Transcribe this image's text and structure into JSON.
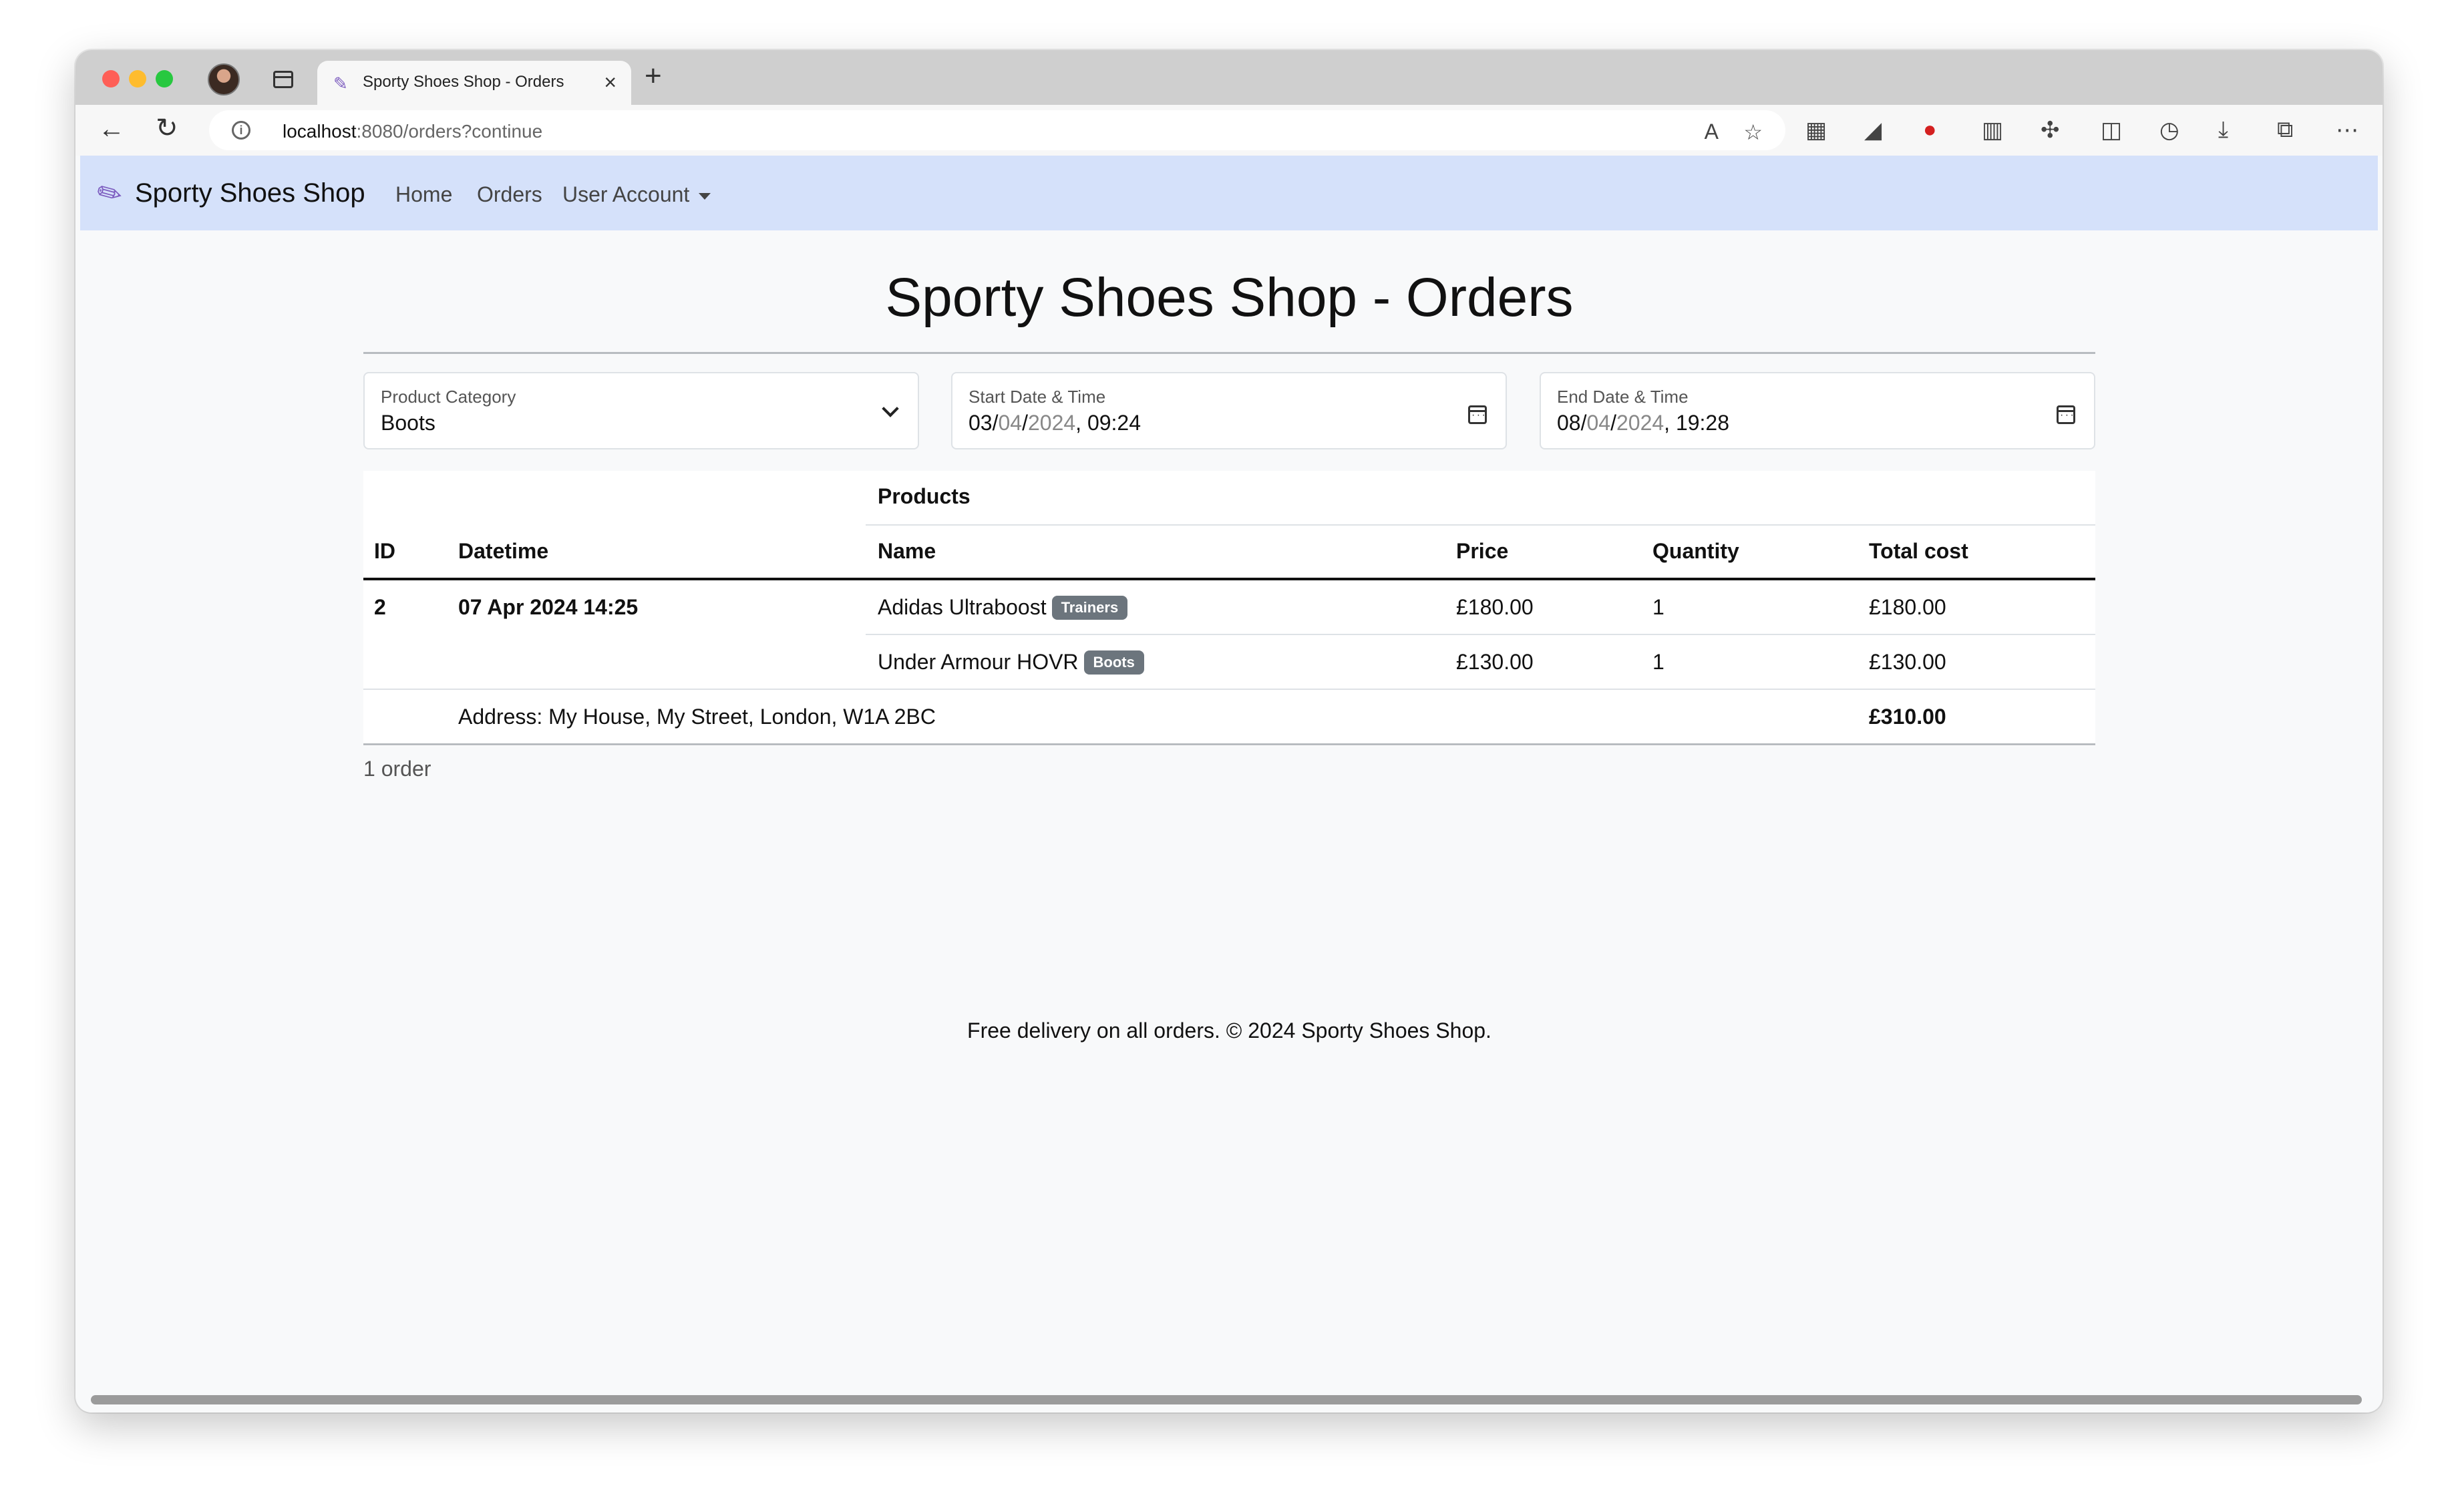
{
  "browser": {
    "tab_title": "Sporty Shoes Shop - Orders",
    "url_host": "localhost",
    "url_rest": ":8080/orders?continue"
  },
  "navbar": {
    "brand": "Sporty Shoes Shop",
    "links": [
      "Home",
      "Orders",
      "User Account"
    ]
  },
  "page": {
    "title": "Sporty Shoes Shop - Orders"
  },
  "filters": {
    "category": {
      "label": "Product Category",
      "value": "Boots"
    },
    "start": {
      "label": "Start Date & Time",
      "d": "03/",
      "m": "04",
      "sep": "/",
      "y": "2024",
      "time": ", 09:24"
    },
    "end": {
      "label": "End Date & Time",
      "d": "08/",
      "m": "04",
      "sep": "/",
      "y": "2024",
      "time": ", 19:28"
    }
  },
  "table": {
    "group_header": "Products",
    "headers": [
      "ID",
      "Datetime",
      "Name",
      "Price",
      "Quantity",
      "Total cost"
    ],
    "order": {
      "id": "2",
      "datetime": "07 Apr 2024 14:25",
      "items": [
        {
          "name": "Adidas Ultraboost",
          "badge": "Trainers",
          "price": "£180.00",
          "quantity": "1",
          "total": "£180.00"
        },
        {
          "name": "Under Armour HOVR",
          "badge": "Boots",
          "price": "£130.00",
          "quantity": "1",
          "total": "£130.00"
        }
      ],
      "address": "Address: My House, My Street, London, W1A 2BC",
      "grand_total": "£310.00"
    }
  },
  "count_text": "1 order",
  "footer": "Free delivery on all orders. © 2024 Sporty Shoes Shop.",
  "icons": {
    "calendar": "calendar-icon",
    "chevron": "chevron-down-icon",
    "brand": "shoe-icon"
  }
}
